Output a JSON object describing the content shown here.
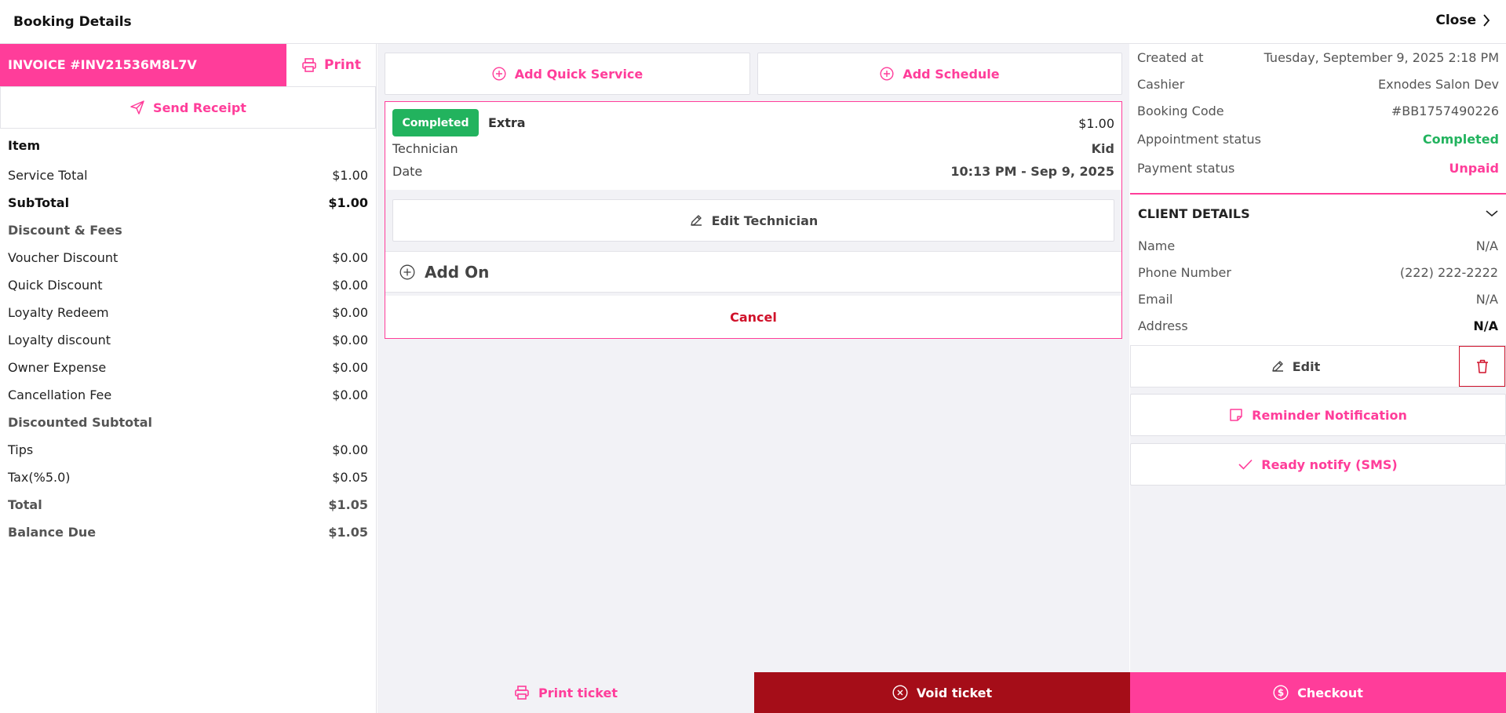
{
  "header": {
    "title": "Booking Details",
    "close_label": "Close"
  },
  "invoice": {
    "number": "INVOICE #INV21536M8L7V",
    "print_label": "Print",
    "send_receipt_label": "Send Receipt"
  },
  "summary": {
    "item_header": "Item",
    "service_total": {
      "label": "Service Total",
      "value": "$1.00"
    },
    "subtotal": {
      "label": "SubTotal",
      "value": "$1.00"
    },
    "discount_section": "Discount & Fees",
    "voucher_discount": {
      "label": "Voucher Discount",
      "value": "$0.00"
    },
    "quick_discount": {
      "label": "Quick Discount",
      "value": "$0.00"
    },
    "loyalty_redeem": {
      "label": "Loyalty Redeem",
      "value": "$0.00"
    },
    "loyalty_discount": {
      "label": "Loyalty discount",
      "value": "$0.00"
    },
    "owner_expense": {
      "label": "Owner Expense",
      "value": "$0.00"
    },
    "cancellation_fee": {
      "label": "Cancellation Fee",
      "value": "$0.00"
    },
    "discounted_subtotal": "Discounted Subtotal",
    "tips": {
      "label": "Tips",
      "value": "$0.00"
    },
    "tax": {
      "label": "Tax(%5.0)",
      "value": "$0.05"
    },
    "total": {
      "label": "Total",
      "value": "$1.05"
    },
    "balance_due": {
      "label": "Balance Due",
      "value": "$1.05"
    }
  },
  "actions": {
    "add_quick_service": "Add Quick Service",
    "add_schedule": "Add Schedule"
  },
  "service": {
    "status": "Completed",
    "name": "Extra",
    "price": "$1.00",
    "technician_label": "Technician",
    "technician_value": "Kid",
    "date_label": "Date",
    "date_value": "10:13 PM - Sep 9, 2025",
    "edit_technician": "Edit Technician",
    "add_on": "Add On",
    "cancel": "Cancel"
  },
  "booking_info": {
    "created_at": {
      "label": "Created at",
      "value": "Tuesday, September 9, 2025 2:18 PM"
    },
    "cashier": {
      "label": "Cashier",
      "value": "Exnodes Salon Dev"
    },
    "booking_code": {
      "label": "Booking Code",
      "value": "#BB1757490226"
    },
    "appointment_status": {
      "label": "Appointment status",
      "value": "Completed"
    },
    "payment_status": {
      "label": "Payment status",
      "value": "Unpaid"
    }
  },
  "client": {
    "header": "CLIENT DETAILS",
    "name": {
      "label": "Name",
      "value": "N/A"
    },
    "phone": {
      "label": "Phone Number",
      "value": "(222) 222-2222"
    },
    "email": {
      "label": "Email",
      "value": "N/A"
    },
    "address": {
      "label": "Address",
      "value": "N/A"
    },
    "edit_label": "Edit"
  },
  "notifications": {
    "reminder": "Reminder Notification",
    "ready": "Ready notify (SMS)"
  },
  "footer": {
    "print_ticket": "Print ticket",
    "void_ticket": "Void ticket",
    "checkout": "Checkout"
  },
  "colors": {
    "accent": "#ff3d9a",
    "success": "#22b35e",
    "danger": "#a50d18",
    "cancel_text": "#d0112a"
  },
  "icons": {
    "close": "chevron-right-icon",
    "print": "printer-icon",
    "send": "send-icon",
    "add": "plus-circle-icon",
    "edit": "pencil-icon",
    "delete": "trash-icon",
    "reminder": "note-icon",
    "ready": "check-icon",
    "void": "x-circle-icon",
    "checkout": "dollar-circle-icon",
    "collapse": "chevron-down-icon"
  }
}
